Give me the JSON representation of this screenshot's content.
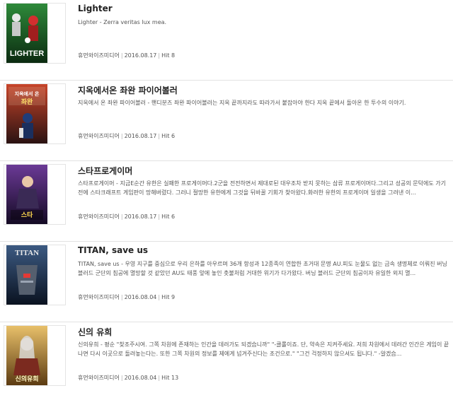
{
  "items": [
    {
      "title": "Lighter",
      "desc": "Lighter - Zerra veritas lux mea.",
      "publisher": "휴먼와이즈미디어",
      "date": "2016.08.17",
      "hit": "Hit 8",
      "cover_title": "LIGHTER",
      "cover_colors": [
        "#1d6b2a",
        "#0f3d16"
      ]
    },
    {
      "title": "지옥에서온 좌완 파이어볼러",
      "desc": "지옥에서 온 좌완 파이어볼러 - 핸디분즈 좌완 파이어볼러는 지옥 끝까지라도 따라가서 붙잡아야 한다 지옥 끝에서 돌아온 한 투수의 이야기.",
      "publisher": "휴먼와이즈미디어",
      "date": "2016.08.17",
      "hit": "Hit 6",
      "cover_title": "지옥에서 온 좌완 파이어볼러",
      "cover_colors": [
        "#b8321f",
        "#3b1a1a"
      ]
    },
    {
      "title": "스타프로게이머",
      "desc": "스타프로게이머 - 지금E순간 유한은 실패한 프로게이머다.2군을 전전하면서 제대로된 대우조차 받지 못하는 삼류 프로게이머다.그리고 성공의 문턱에도 가기 전에 스타크래프트 게임판이 망해버렸다. 그러니 절망한 유한에게 그것을 뒤바꿀 기회가 찾아왔다.화려한 유한의 프로게이머 일생을 그려낸 이...",
      "publisher": "휴먼와이즈미디어",
      "date": "2016.08.17",
      "hit": "Hit 6",
      "cover_title": "스타프로게이머",
      "cover_colors": [
        "#5a2d7a",
        "#1a0f2e"
      ]
    },
    {
      "title": "TITAN, save us",
      "desc": "TITAN, save us - 우영 지구를 중심으로 우리 은하를 아우르며 36개 항성과 12종족이 연합한 초거대 문명 AU.피도 눈물도 없는 금속 생명체로 이뤄진 버닝 블러드 군단의 침공에 멸망할 것 같았던 AU도 태풍 앞에 놓인 촛불처럼 거대한 위기가 다가왔다. 버닝 블러드 군단의 침공이자 유일한 외지 멸...",
      "publisher": "휴먼와이즈미디어",
      "date": "2016.08.04",
      "hit": "Hit 9",
      "cover_title": "TITAN",
      "cover_colors": [
        "#2a3f5e",
        "#0d1522"
      ]
    },
    {
      "title": "신의 유희",
      "desc": "신의유희 - 평순 \"찾조주시여. 그쪽 차원에 존재하는 인간을 데려가도 되겠습니까\" \"-클롤이죠. 단, 약속은 지켜주세요. 저희 차원에서 데려간 인간은 게임이 끝나면 다시 이곳으로 돌려놓는다는. 또한 그쪽 차원의 정보를 제에게 넘겨주신다는 조건으로.\" \"그건 걱정하지 않으셔도 됩니다.\" -알겠습...",
      "publisher": "휴먼와이즈미디어",
      "date": "2016.08.04",
      "hit": "Hit 13",
      "cover_title": "신의 유희",
      "cover_colors": [
        "#d9a441",
        "#6b4a1a"
      ]
    }
  ]
}
